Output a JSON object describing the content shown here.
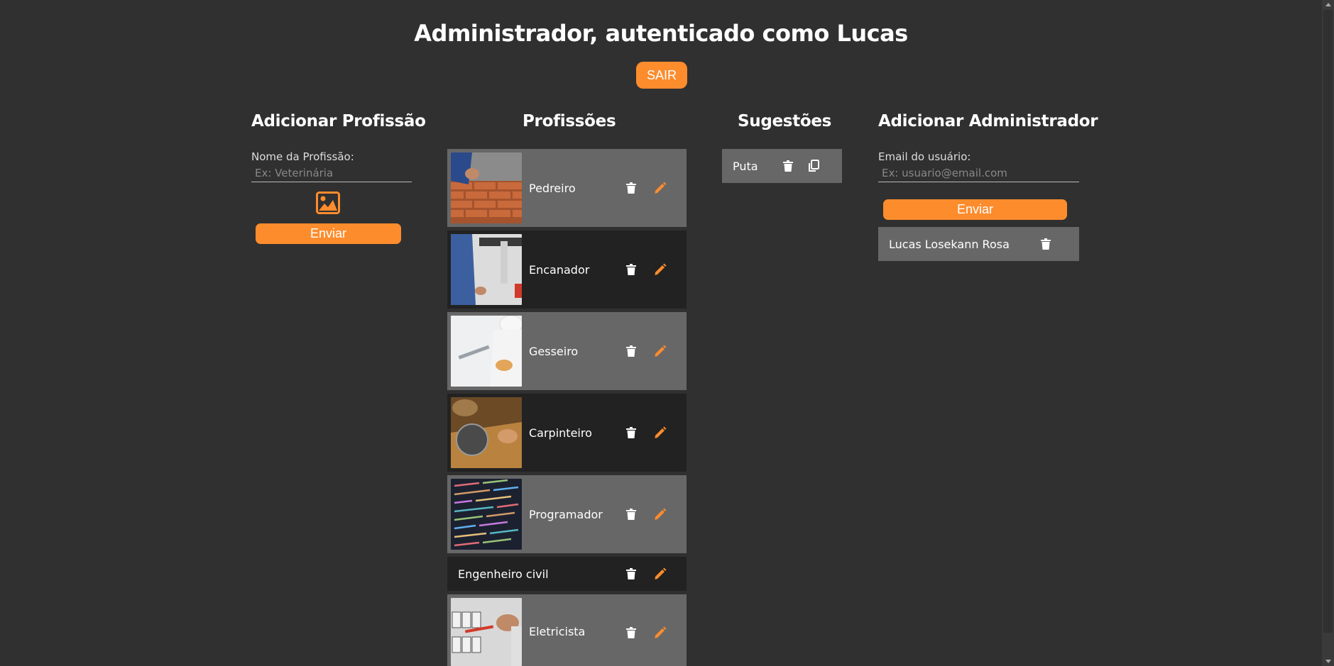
{
  "header": {
    "title": "Administrador, autenticado como Lucas",
    "logout_label": "SAIR"
  },
  "add_profession": {
    "title": "Adicionar Profissão",
    "name_label": "Nome da Profissão:",
    "name_placeholder": "Ex: Veterinária",
    "name_value": "",
    "submit_label": "Enviar",
    "image_icon": "image-icon"
  },
  "professions": {
    "title": "Profissões",
    "items": [
      {
        "label": "Pedreiro",
        "has_image": true,
        "image_icon": "bricklayer-photo"
      },
      {
        "label": "Encanador",
        "has_image": true,
        "image_icon": "plumber-photo"
      },
      {
        "label": "Gesseiro",
        "has_image": true,
        "image_icon": "plasterer-photo"
      },
      {
        "label": "Carpinteiro",
        "has_image": true,
        "image_icon": "carpenter-photo"
      },
      {
        "label": "Programador",
        "has_image": true,
        "image_icon": "programmer-photo"
      },
      {
        "label": "Engenheiro civil",
        "has_image": false
      },
      {
        "label": "Eletricista",
        "has_image": true,
        "image_icon": "electrician-photo"
      }
    ]
  },
  "suggestions": {
    "title": "Sugestões",
    "items": [
      {
        "label": "Puta"
      }
    ]
  },
  "add_admin": {
    "title": "Adicionar Administrador",
    "email_label": "Email do usuário:",
    "email_placeholder": "Ex: usuario@email.com",
    "email_value": "",
    "submit_label": "Enviar",
    "admins": [
      {
        "label": "Lucas Losekann Rosa"
      }
    ]
  },
  "colors": {
    "background": "#303030",
    "accent": "#fd8c2d",
    "row_light": "#676767",
    "row_dark": "#222222"
  }
}
